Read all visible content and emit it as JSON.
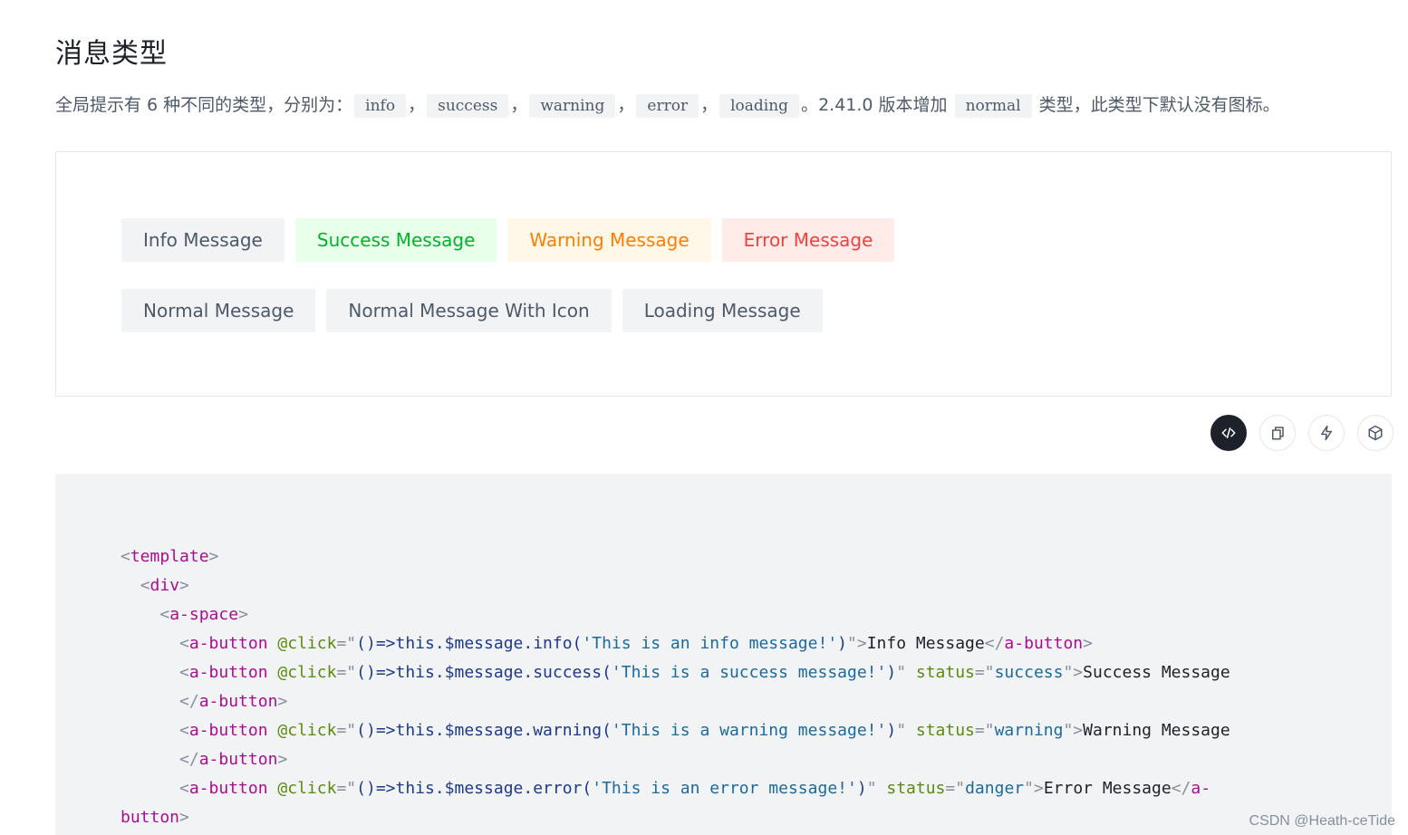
{
  "heading": "消息类型",
  "description": {
    "prefix": "全局提示有 6 种不同的类型，分别为：",
    "types": [
      "info",
      "success",
      "warning",
      "error",
      "loading"
    ],
    "separator": "，",
    "middle": "。2.41.0 版本增加",
    "extra_type": "normal",
    "suffix": "类型，此类型下默认没有图标。"
  },
  "demo": {
    "row1": [
      "Info Message",
      "Success Message",
      "Warning Message",
      "Error Message"
    ],
    "row2": [
      "Normal Message",
      "Normal Message With Icon",
      "Loading Message"
    ]
  },
  "colors": {
    "success": "#00b42a",
    "warning": "#ff7d00",
    "danger": "#f53f3f",
    "neutral": "#4e5969"
  },
  "actions": [
    "code-icon",
    "copy-icon",
    "lightning-icon",
    "codesandbox-icon"
  ],
  "code": {
    "l1_open": "<",
    "l1_tag": "template",
    "l1_close": ">",
    "l2_indent": "  ",
    "l2_open": "<",
    "l2_tag": "div",
    "l2_close": ">",
    "l3_indent": "    ",
    "l3_open": "<",
    "l3_tag": "a-space",
    "l3_close": ">",
    "indent": "      ",
    "btn_open": "<",
    "btn_tag": "a-button",
    "click_attr": "@click",
    "eq": "=",
    "quote": "\"",
    "status_attr": "status",
    "gt": ">",
    "close_open": "</",
    "end_tag_head": "a-",
    "end_tag_tail": "button",
    "l4_call": "()=>this.$message.info(",
    "l4_arg": "'This is an info message!'",
    "l4_paren": ")",
    "l4_text": "Info Message",
    "l5_call": "()=>this.$message.success(",
    "l5_arg": "'This is a success message!'",
    "l5_paren": ")",
    "l5_status": "success",
    "l5_text": "Success Message",
    "l7_call": "()=>this.$message.warning(",
    "l7_arg": "'This is a warning message!'",
    "l7_paren": ")",
    "l7_status": "warning",
    "l7_text": "Warning Message",
    "l9_call": "()=>this.$message.error(",
    "l9_arg": "'This is an error message!'",
    "l9_paren": ")",
    "l9_status": "danger",
    "l9_text": "Error Message"
  },
  "watermark": "CSDN @Heath-ceTide"
}
